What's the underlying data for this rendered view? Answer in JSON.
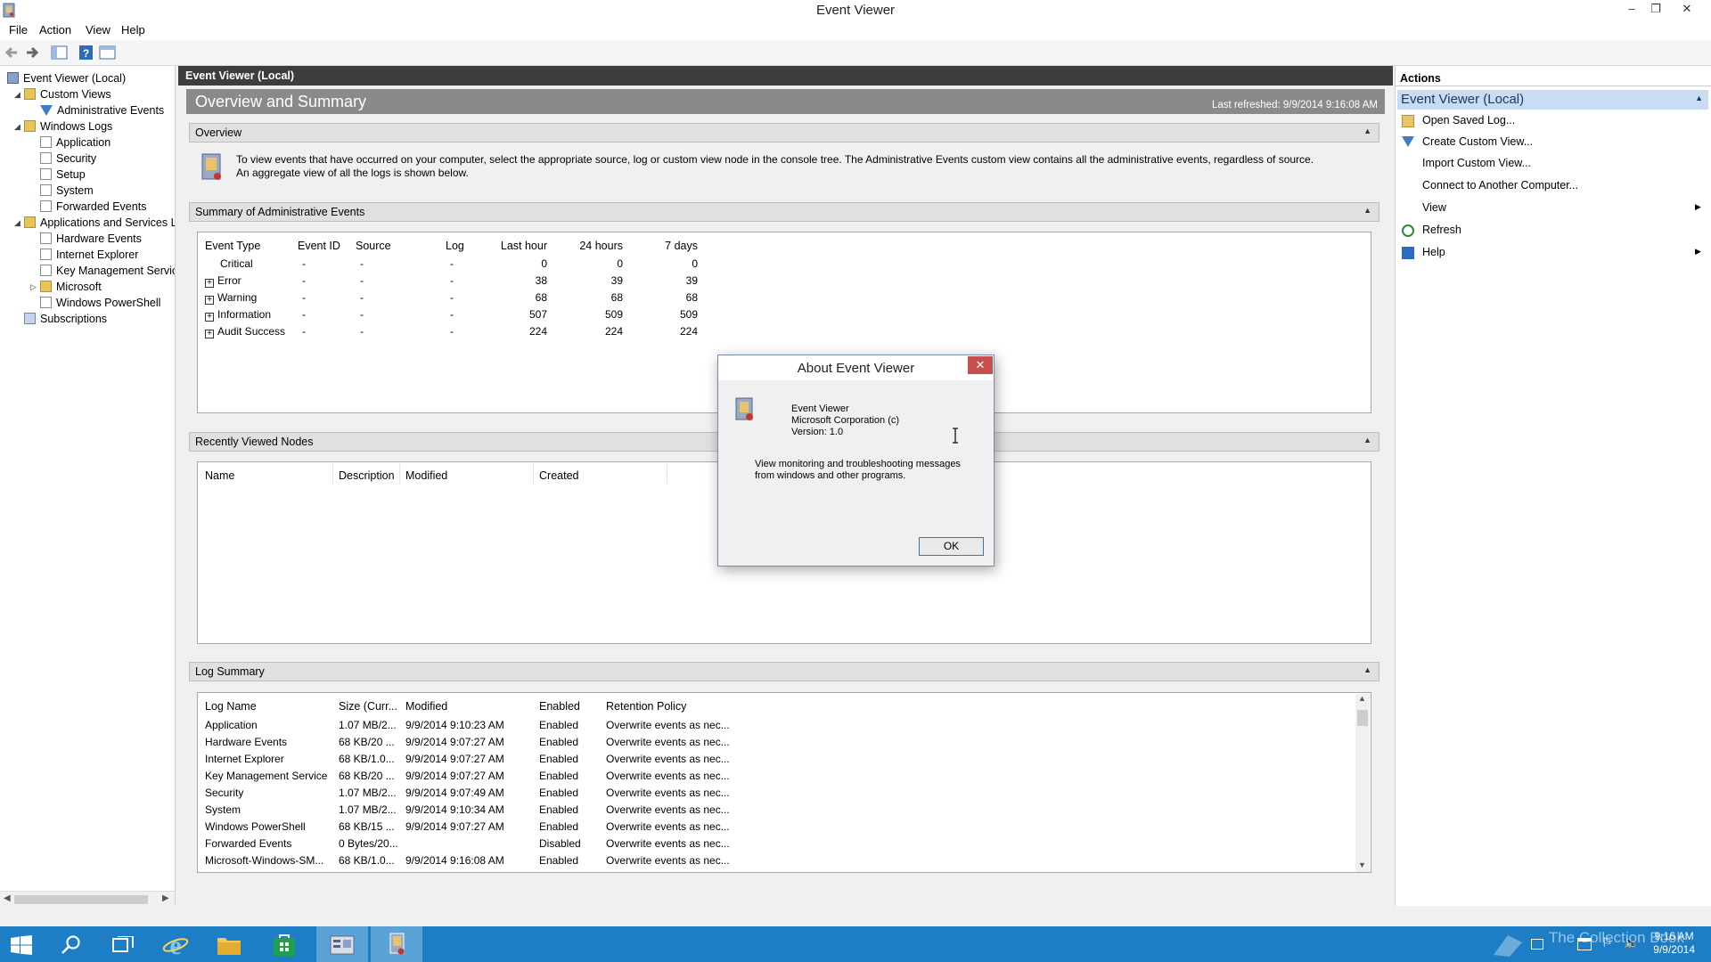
{
  "window": {
    "title": "Event Viewer",
    "controls": [
      "–",
      "❐",
      "✕"
    ]
  },
  "menubar": {
    "items": [
      "File",
      "Action",
      "View",
      "Help"
    ]
  },
  "tree": {
    "items": [
      {
        "label": "Event Viewer (Local)",
        "level": 0,
        "icon": "event-viewer-icon"
      },
      {
        "label": "Custom Views",
        "level": 1,
        "icon": "folder-icon",
        "expanded": true
      },
      {
        "label": "Administrative Events",
        "level": 2,
        "icon": "filter-icon"
      },
      {
        "label": "Windows Logs",
        "level": 1,
        "icon": "folder-icon",
        "expanded": true
      },
      {
        "label": "Application",
        "level": 2,
        "icon": "log-icon"
      },
      {
        "label": "Security",
        "level": 2,
        "icon": "log-icon"
      },
      {
        "label": "Setup",
        "level": 2,
        "icon": "log-icon"
      },
      {
        "label": "System",
        "level": 2,
        "icon": "log-icon"
      },
      {
        "label": "Forwarded Events",
        "level": 2,
        "icon": "log-icon"
      },
      {
        "label": "Applications and Services Lo",
        "level": 1,
        "icon": "folder-icon",
        "expanded": true
      },
      {
        "label": "Hardware Events",
        "level": 2,
        "icon": "log-icon"
      },
      {
        "label": "Internet Explorer",
        "level": 2,
        "icon": "log-icon"
      },
      {
        "label": "Key Management Service",
        "level": 2,
        "icon": "log-icon"
      },
      {
        "label": "Microsoft",
        "level": 2,
        "icon": "folder-icon",
        "expandable": true
      },
      {
        "label": "Windows PowerShell",
        "level": 2,
        "icon": "log-icon"
      },
      {
        "label": "Subscriptions",
        "level": 1,
        "icon": "subscriptions-icon"
      }
    ]
  },
  "center": {
    "header": "Event Viewer (Local)",
    "title": "Overview and Summary",
    "last_refreshed": "Last refreshed: 9/9/2014 9:16:08 AM",
    "overview": {
      "label": "Overview",
      "text": "To view events that have occurred on your computer, select the appropriate source, log or custom view node in the console tree. The Administrative Events custom view contains all the administrative events, regardless of source. An aggregate view of all the logs is shown below."
    },
    "summary": {
      "label": "Summary of Administrative Events",
      "columns": [
        "Event Type",
        "Event ID",
        "Source",
        "Log",
        "Last hour",
        "24 hours",
        "7 days"
      ],
      "rows": [
        {
          "type": "Critical",
          "id": "-",
          "source": "-",
          "log": "-",
          "hour": "0",
          "day": "0",
          "week": "0",
          "expandable": false
        },
        {
          "type": "Error",
          "id": "-",
          "source": "-",
          "log": "-",
          "hour": "38",
          "day": "39",
          "week": "39",
          "expandable": true
        },
        {
          "type": "Warning",
          "id": "-",
          "source": "-",
          "log": "-",
          "hour": "68",
          "day": "68",
          "week": "68",
          "expandable": true
        },
        {
          "type": "Information",
          "id": "-",
          "source": "-",
          "log": "-",
          "hour": "507",
          "day": "509",
          "week": "509",
          "expandable": true
        },
        {
          "type": "Audit Success",
          "id": "-",
          "source": "-",
          "log": "-",
          "hour": "224",
          "day": "224",
          "week": "224",
          "expandable": true
        }
      ]
    },
    "recent": {
      "label": "Recently Viewed Nodes",
      "columns": [
        "Name",
        "Description",
        "Modified",
        "Created"
      ]
    },
    "log_summary": {
      "label": "Log Summary",
      "columns": [
        "Log Name",
        "Size (Curr...",
        "Modified",
        "Enabled",
        "Retention Policy"
      ],
      "rows": [
        [
          "Application",
          "1.07 MB/2...",
          "9/9/2014 9:10:23 AM",
          "Enabled",
          "Overwrite events as nec..."
        ],
        [
          "Hardware Events",
          "68 KB/20 ...",
          "9/9/2014 9:07:27 AM",
          "Enabled",
          "Overwrite events as nec..."
        ],
        [
          "Internet Explorer",
          "68 KB/1.0...",
          "9/9/2014 9:07:27 AM",
          "Enabled",
          "Overwrite events as nec..."
        ],
        [
          "Key Management Service",
          "68 KB/20 ...",
          "9/9/2014 9:07:27 AM",
          "Enabled",
          "Overwrite events as nec..."
        ],
        [
          "Security",
          "1.07 MB/2...",
          "9/9/2014 9:07:49 AM",
          "Enabled",
          "Overwrite events as nec..."
        ],
        [
          "System",
          "1.07 MB/2...",
          "9/9/2014 9:10:34 AM",
          "Enabled",
          "Overwrite events as nec..."
        ],
        [
          "Windows PowerShell",
          "68 KB/15 ...",
          "9/9/2014 9:07:27 AM",
          "Enabled",
          "Overwrite events as nec..."
        ],
        [
          "Forwarded Events",
          "0 Bytes/20...",
          "",
          "Disabled",
          "Overwrite events as nec..."
        ],
        [
          "Microsoft-Windows-SM...",
          "68 KB/1.0...",
          "9/9/2014 9:16:08 AM",
          "Enabled",
          "Overwrite events as nec..."
        ]
      ]
    }
  },
  "actions": {
    "title": "Actions",
    "subtitle": "Event Viewer (Local)",
    "items": [
      {
        "label": "Open Saved Log...",
        "icon": "open-log-icon"
      },
      {
        "label": "Create Custom View...",
        "icon": "filter-icon"
      },
      {
        "label": "Import Custom View...",
        "icon": ""
      },
      {
        "label": "Connect to Another Computer...",
        "icon": ""
      },
      {
        "label": "View",
        "icon": "",
        "submenu": true
      },
      {
        "label": "Refresh",
        "icon": "refresh-icon"
      },
      {
        "label": "Help",
        "icon": "help-icon",
        "submenu": true
      }
    ]
  },
  "dialog": {
    "title": "About Event Viewer",
    "close": "✕",
    "product": "Event Viewer",
    "company": "Microsoft Corporation (c)",
    "version": "Version: 1.0",
    "description_line1": "View monitoring and troubleshooting messages",
    "description_line2": "from windows and other programs.",
    "ok": "OK"
  },
  "taskbar": {
    "time": "9:16 AM",
    "date": "9/9/2014",
    "watermark": "The Collection Book"
  },
  "colors": {
    "accent": "#1d7ec6",
    "header_dark": "#3d3d3d",
    "title_gray": "#8a8a8a",
    "close_red": "#c7504f",
    "actions_highlight": "#c8dcf2"
  }
}
